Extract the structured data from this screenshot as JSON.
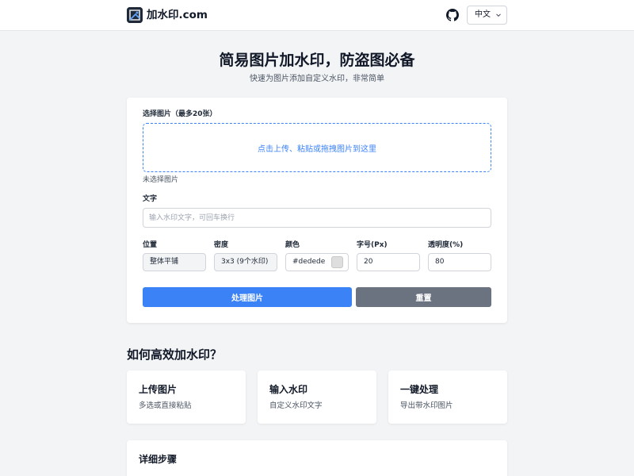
{
  "header": {
    "brand": "加水印.com",
    "logo_icon": "brand-logo-icon",
    "github_icon": "github-icon",
    "language": "中文"
  },
  "hero": {
    "title": "简易图片加水印，防盗图必备",
    "subtitle": "快速为图片添加自定义水印，非常简单"
  },
  "form": {
    "image_label": "选择图片（最多20张）",
    "dropzone_text": "点击上传、粘贴或拖拽图片到这里",
    "no_file_text": "未选择图片",
    "text_label": "文字",
    "text_placeholder": "输入水印文字，可回车换行",
    "position_label": "位置",
    "position_value": "整体平铺",
    "density_label": "密度",
    "density_value": "3x3 (9个水印)",
    "color_label": "颜色",
    "color_value": "#dedede",
    "font_size_label": "字号(Px)",
    "font_size_value": "20",
    "opacity_label": "透明度(%)",
    "opacity_value": "80",
    "process_button": "处理图片",
    "reset_button": "重置"
  },
  "how": {
    "title": "如何高效加水印？",
    "features": [
      {
        "title": "上传图片",
        "desc": "多选或直接粘贴"
      },
      {
        "title": "输入水印",
        "desc": "自定义水印文字"
      },
      {
        "title": "一键处理",
        "desc": "导出带水印图片"
      }
    ]
  },
  "steps": {
    "title": "详细步骤"
  },
  "colors": {
    "accent": "#3b82f6",
    "reset": "#6b7280",
    "swatch": "#dedede",
    "background": "#f3f4f6"
  }
}
